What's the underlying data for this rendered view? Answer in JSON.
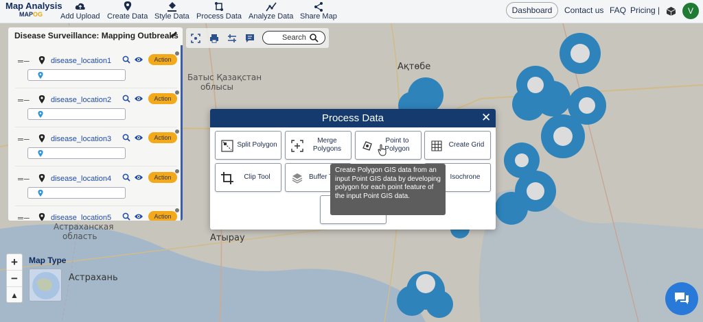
{
  "app": {
    "logo_line1": "Map Analysis",
    "logo_line2_a": "MAP",
    "logo_line2_b": "OG"
  },
  "nav": {
    "items": [
      {
        "label": "Add Upload",
        "icon": "cloud-upload-icon"
      },
      {
        "label": "Create Data",
        "icon": "map-pin-icon"
      },
      {
        "label": "Style Data",
        "icon": "paint-bucket-icon"
      },
      {
        "label": "Process Data",
        "icon": "process-icon"
      },
      {
        "label": "Analyze Data",
        "icon": "analyze-icon"
      },
      {
        "label": "Share Map",
        "icon": "share-icon"
      }
    ],
    "dashboard": "Dashboard",
    "contact": "Contact us",
    "faq": "FAQ",
    "pricing": "Pricing |",
    "avatar": "V"
  },
  "panel": {
    "title": "Disease Surveillance: Mapping Outbreaks",
    "layers": [
      {
        "name": "disease_location1",
        "action": "Action"
      },
      {
        "name": "disease_location2",
        "action": "Action"
      },
      {
        "name": "disease_location3",
        "action": "Action"
      },
      {
        "name": "disease_location4",
        "action": "Action"
      },
      {
        "name": "disease_location5",
        "action": "Action"
      }
    ]
  },
  "toolbar": {
    "search_label": "Search"
  },
  "map": {
    "labels": {
      "aktobe": "Ақтөбе",
      "west_kz_1": "Батыс Қазақстан",
      "west_kz_2": "облысы",
      "astrakhan_obl_1": "Астраханская",
      "astrakhan_obl_2": "область",
      "atyrau": "Атырау",
      "astrakhan": "Астрахань"
    },
    "marker_color": "#2b93d6",
    "map_type_label": "Map Type",
    "zoom_in": "+",
    "zoom_out": "−",
    "reset_north": "▲"
  },
  "modal": {
    "title": "Process Data",
    "close": "✕",
    "tools": [
      {
        "label": "Split Polygon",
        "icon": "split-polygon-icon"
      },
      {
        "label": "Merge Polygons",
        "icon": "merge-polygons-icon"
      },
      {
        "label": "Point to Polygon",
        "icon": "point-to-polygon-icon"
      },
      {
        "label": "Create Grid",
        "icon": "grid-icon"
      },
      {
        "label": "Clip Tool",
        "icon": "crop-icon"
      },
      {
        "label": "Buffer T",
        "icon": "buffer-icon"
      },
      {
        "label": "Isochrone",
        "icon": "isochrone-icon"
      }
    ],
    "tooltip": "Create Polygon GIS data from an input Point GIS data by developing polygon for each point feature of the input Point GIS data.",
    "header_color": "#143a6e"
  }
}
